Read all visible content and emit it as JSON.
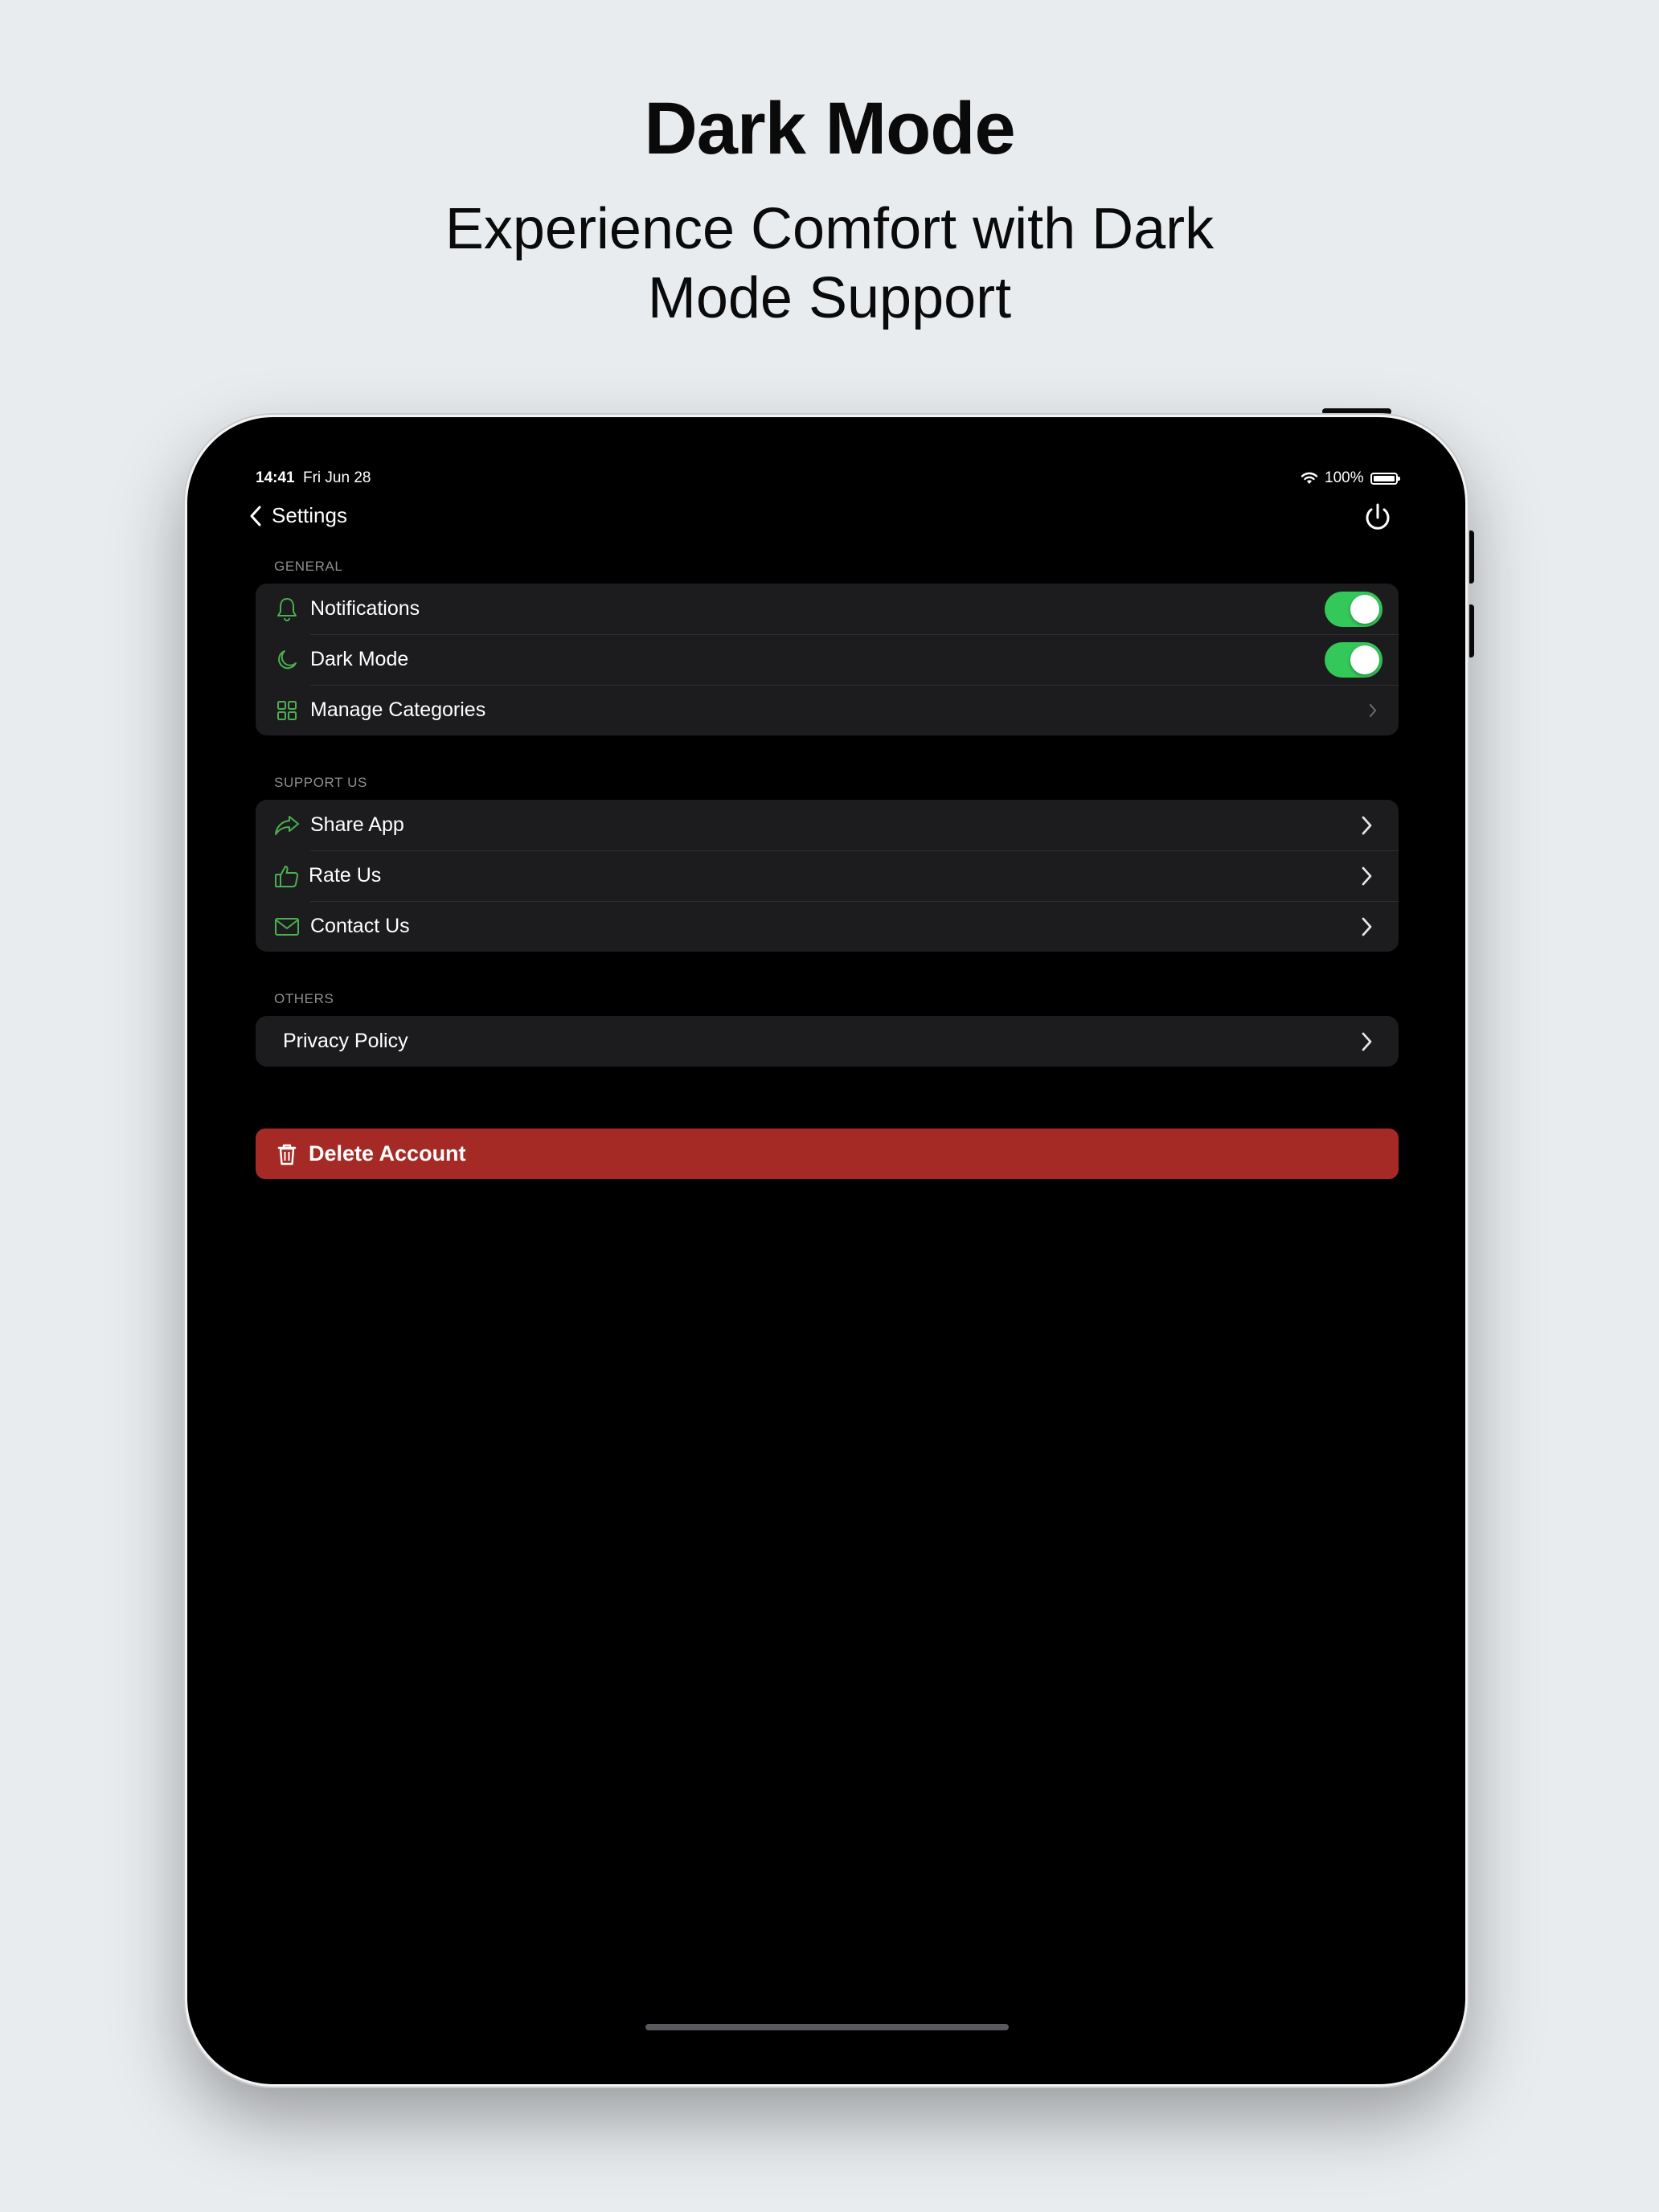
{
  "hero": {
    "title": "Dark Mode",
    "subtitle": "Experience Comfort with Dark Mode Support"
  },
  "status_bar": {
    "time": "14:41",
    "date": "Fri Jun 28",
    "battery": "100%"
  },
  "nav": {
    "back_label": "Settings",
    "back_icon": "chevron-left-icon",
    "right_icon": "power-icon"
  },
  "sections": {
    "general": {
      "header": "GENERAL",
      "items": [
        {
          "label": "Notifications",
          "icon": "bell-icon",
          "control": "toggle",
          "value": true
        },
        {
          "label": "Dark Mode",
          "icon": "moon-icon",
          "control": "toggle",
          "value": true
        },
        {
          "label": "Manage Categories",
          "icon": "grid-icon",
          "control": "chevron"
        }
      ]
    },
    "support": {
      "header": "SUPPORT US",
      "items": [
        {
          "label": "Share App",
          "icon": "share-arrow-icon",
          "control": "chevron"
        },
        {
          "label": "Rate Us",
          "icon": "thumbs-up-icon",
          "control": "chevron"
        },
        {
          "label": "Contact Us",
          "icon": "envelope-icon",
          "control": "chevron"
        }
      ]
    },
    "others": {
      "header": "OTHERS",
      "items": [
        {
          "label": "Privacy Policy",
          "control": "chevron"
        }
      ]
    }
  },
  "delete_account": {
    "label": "Delete Account",
    "icon": "trash-icon"
  },
  "colors": {
    "accent_green": "#34c759",
    "icon_green": "#4caf50",
    "danger_red": "#a52a26",
    "cell_background": "#1c1c1e",
    "screen_background": "#000000",
    "page_background": "#e9ecef"
  }
}
